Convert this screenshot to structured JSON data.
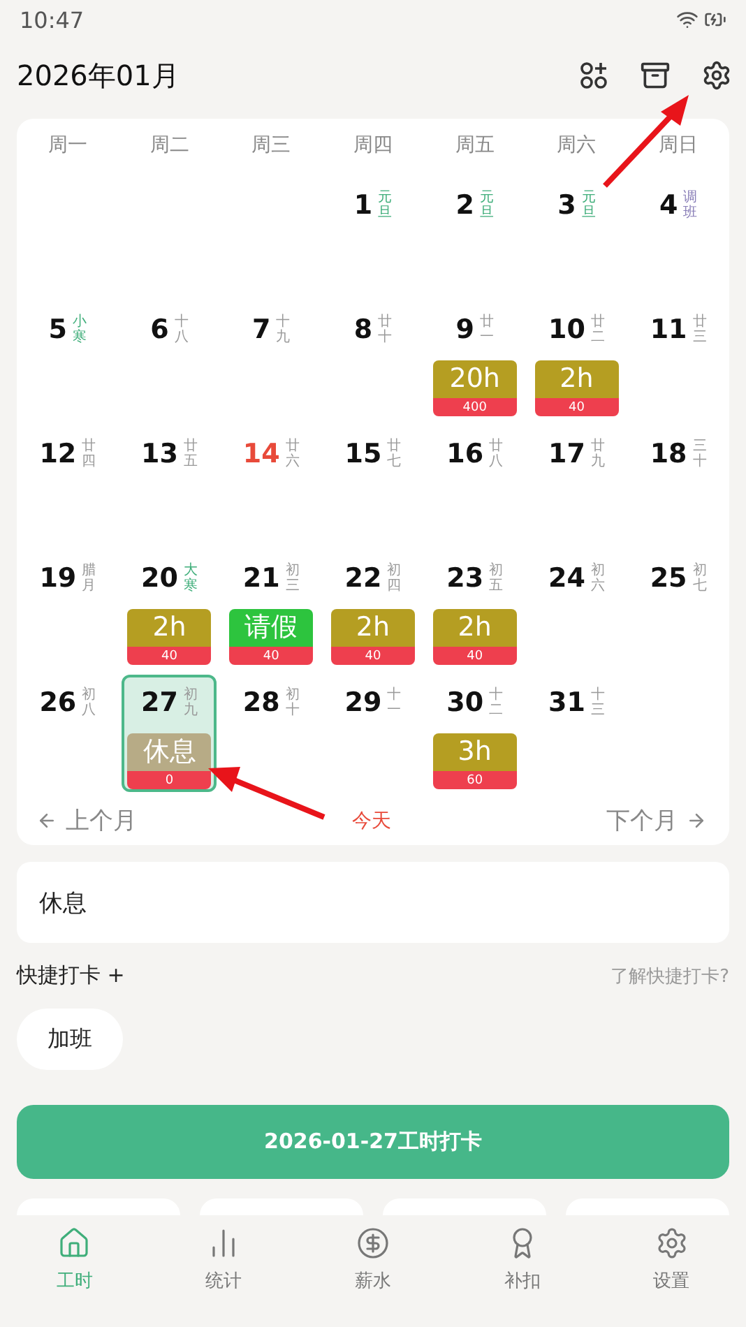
{
  "status_bar": {
    "time": "10:47"
  },
  "header": {
    "title": "2026年01月"
  },
  "calendar": {
    "weekdays": [
      "周一",
      "周二",
      "周三",
      "周四",
      "周五",
      "周六",
      "周日"
    ],
    "weeks": [
      [
        {
          "day": "1",
          "lunar": "元旦",
          "color": "#3fae7a"
        },
        {
          "day": "2",
          "lunar": "元旦",
          "color": "#3fae7a"
        },
        {
          "day": "3",
          "lunar": "元旦",
          "color": "#3fae7a"
        },
        {
          "day": "4",
          "lunar": "调班",
          "color": "#8a7fb8"
        }
      ],
      [
        {
          "day": "5",
          "lunar": "小寒",
          "color": "#3fae7a"
        },
        {
          "day": "6",
          "lunar": "十八",
          "color": "#999999"
        },
        {
          "day": "7",
          "lunar": "十九",
          "color": "#999999"
        },
        {
          "day": "8",
          "lunar": "廿十",
          "color": "#999999"
        },
        {
          "day": "9",
          "lunar": "廿一",
          "color": "#999999",
          "entry": {
            "kind": "hours",
            "label": "20h",
            "amount": "400"
          }
        },
        {
          "day": "10",
          "lunar": "廿二",
          "color": "#999999",
          "entry": {
            "kind": "hours",
            "label": "2h",
            "amount": "40"
          }
        },
        {
          "day": "11",
          "lunar": "廿三",
          "color": "#999999"
        }
      ],
      [
        {
          "day": "12",
          "lunar": "廿四",
          "color": "#999999"
        },
        {
          "day": "13",
          "lunar": "廿五",
          "color": "#999999"
        },
        {
          "day": "14",
          "lunar": "廿六",
          "color": "#999999",
          "today": true
        },
        {
          "day": "15",
          "lunar": "廿七",
          "color": "#999999"
        },
        {
          "day": "16",
          "lunar": "廿八",
          "color": "#999999"
        },
        {
          "day": "17",
          "lunar": "廿九",
          "color": "#999999"
        },
        {
          "day": "18",
          "lunar": "三十",
          "color": "#999999"
        }
      ],
      [
        {
          "day": "19",
          "lunar": "腊月",
          "color": "#999999"
        },
        {
          "day": "20",
          "lunar": "大寒",
          "color": "#3fae7a",
          "entry": {
            "kind": "hours",
            "label": "2h",
            "amount": "40"
          }
        },
        {
          "day": "21",
          "lunar": "初三",
          "color": "#999999",
          "entry": {
            "kind": "leave",
            "label": "请假",
            "amount": "40"
          }
        },
        {
          "day": "22",
          "lunar": "初四",
          "color": "#999999",
          "entry": {
            "kind": "hours",
            "label": "2h",
            "amount": "40"
          }
        },
        {
          "day": "23",
          "lunar": "初五",
          "color": "#999999",
          "entry": {
            "kind": "hours",
            "label": "2h",
            "amount": "40"
          }
        },
        {
          "day": "24",
          "lunar": "初六",
          "color": "#999999"
        },
        {
          "day": "25",
          "lunar": "初七",
          "color": "#999999"
        }
      ],
      [
        {
          "day": "26",
          "lunar": "初八",
          "color": "#999999"
        },
        {
          "day": "27",
          "lunar": "初九",
          "color": "#999999",
          "selected": true,
          "entry": {
            "kind": "rest",
            "label": "休息",
            "amount": "0"
          }
        },
        {
          "day": "28",
          "lunar": "初十",
          "color": "#999999"
        },
        {
          "day": "29",
          "lunar": "十一",
          "color": "#999999"
        },
        {
          "day": "30",
          "lunar": "十二",
          "color": "#999999",
          "entry": {
            "kind": "hours",
            "label": "3h",
            "amount": "60"
          }
        },
        {
          "day": "31",
          "lunar": "十三",
          "color": "#999999"
        }
      ]
    ],
    "prev": "上个月",
    "today": "今天",
    "next": "下个月"
  },
  "note": "休息",
  "quick": {
    "title": "快捷打卡 +",
    "help": "了解快捷打卡?",
    "chips": [
      "加班"
    ]
  },
  "punch_button": "2026-01-27工时打卡",
  "bottom_nav": [
    {
      "label": "工时",
      "selected": true
    },
    {
      "label": "统计",
      "selected": false
    },
    {
      "label": "薪水",
      "selected": false
    },
    {
      "label": "补扣",
      "selected": false
    },
    {
      "label": "设置",
      "selected": false
    }
  ]
}
